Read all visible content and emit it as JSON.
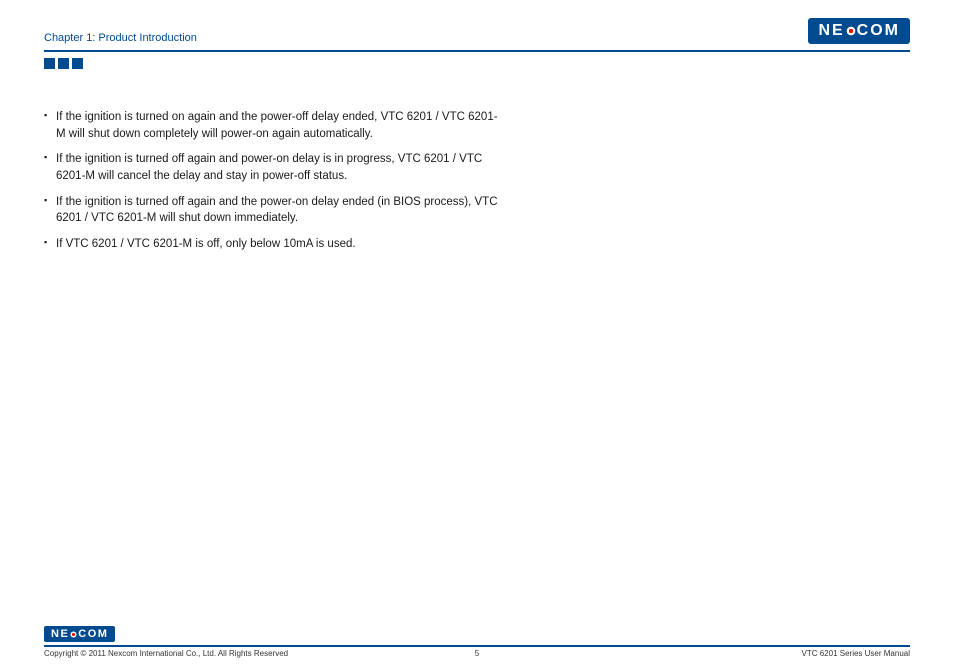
{
  "header": {
    "chapter_title": "Chapter 1: Product Introduction",
    "logo_text_left": "NE",
    "logo_text_right": "COM"
  },
  "content": {
    "bullets": [
      "If the ignition is turned on again and the power-off delay ended, VTC 6201 / VTC 6201-M will shut down completely will power-on again automatically.",
      "If the ignition is turned off again and power-on delay is in progress, VTC 6201 / VTC 6201-M will cancel the delay and stay in power-off status.",
      "If the ignition is turned off again and the power-on delay ended (in BIOS process), VTC 6201 / VTC 6201-M will shut down immediately.",
      "If VTC 6201 / VTC 6201-M is off, only below 10mA is used."
    ]
  },
  "footer": {
    "logo_text_left": "NE",
    "logo_text_right": "COM",
    "copyright": "Copyright © 2011 Nexcom International Co., Ltd. All Rights Reserved",
    "page_number": "5",
    "manual_title": "VTC 6201 Series User Manual"
  }
}
